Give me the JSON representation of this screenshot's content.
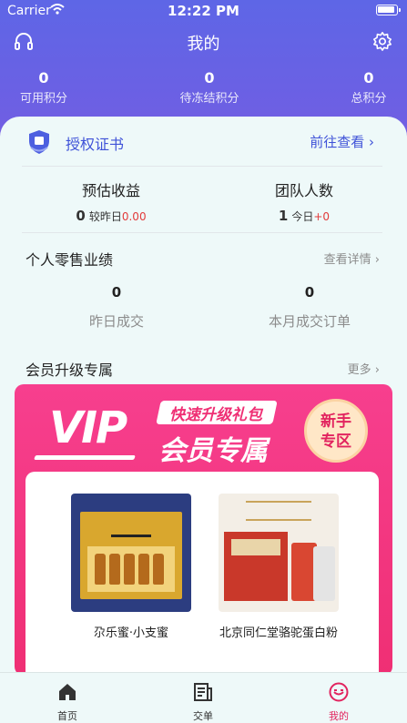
{
  "status_bar": {
    "carrier": "Carrier",
    "time": "12:22 PM"
  },
  "nav": {
    "title": "我的",
    "left_icon": "headset-icon",
    "right_icon": "gear-icon"
  },
  "points": [
    {
      "value": "0",
      "label": "可用积分"
    },
    {
      "value": "0",
      "label": "待冻结积分"
    },
    {
      "value": "0",
      "label": "总积分"
    }
  ],
  "certificate": {
    "title": "授权证书",
    "link": "前往查看",
    "icon": "shield-icon"
  },
  "earnings": [
    {
      "title": "预估收益",
      "value": "0",
      "compare_label": "较昨日",
      "compare_value": "0.00"
    },
    {
      "title": "团队人数",
      "value": "1",
      "compare_label": "今日",
      "compare_value": "+0"
    }
  ],
  "retail": {
    "title": "个人零售业绩",
    "link": "查看详情",
    "stats": [
      {
        "value": "0",
        "label": "昨日成交"
      },
      {
        "value": "0",
        "label": "本月成交订单"
      }
    ]
  },
  "membership": {
    "title": "会员升级专属",
    "link": "更多",
    "banner": {
      "vip": "VIP",
      "tag": "快速升级礼包",
      "headline": "会员专属",
      "badge_line1": "新手",
      "badge_line2": "专区"
    },
    "products": [
      {
        "name": "尕乐蜜·小支蜜"
      },
      {
        "name": "北京同仁堂骆驼蛋白粉"
      }
    ]
  },
  "tabbar": [
    {
      "label": "首页",
      "icon": "home-icon",
      "active": false
    },
    {
      "label": "交单",
      "icon": "document-icon",
      "active": false
    },
    {
      "label": "我的",
      "icon": "smiley-icon",
      "active": true
    }
  ],
  "colors": {
    "header": "#6e5fe3",
    "accent_blue": "#3f52d8",
    "accent_pink": "#ef2f74",
    "negative": "#e23b3b"
  }
}
